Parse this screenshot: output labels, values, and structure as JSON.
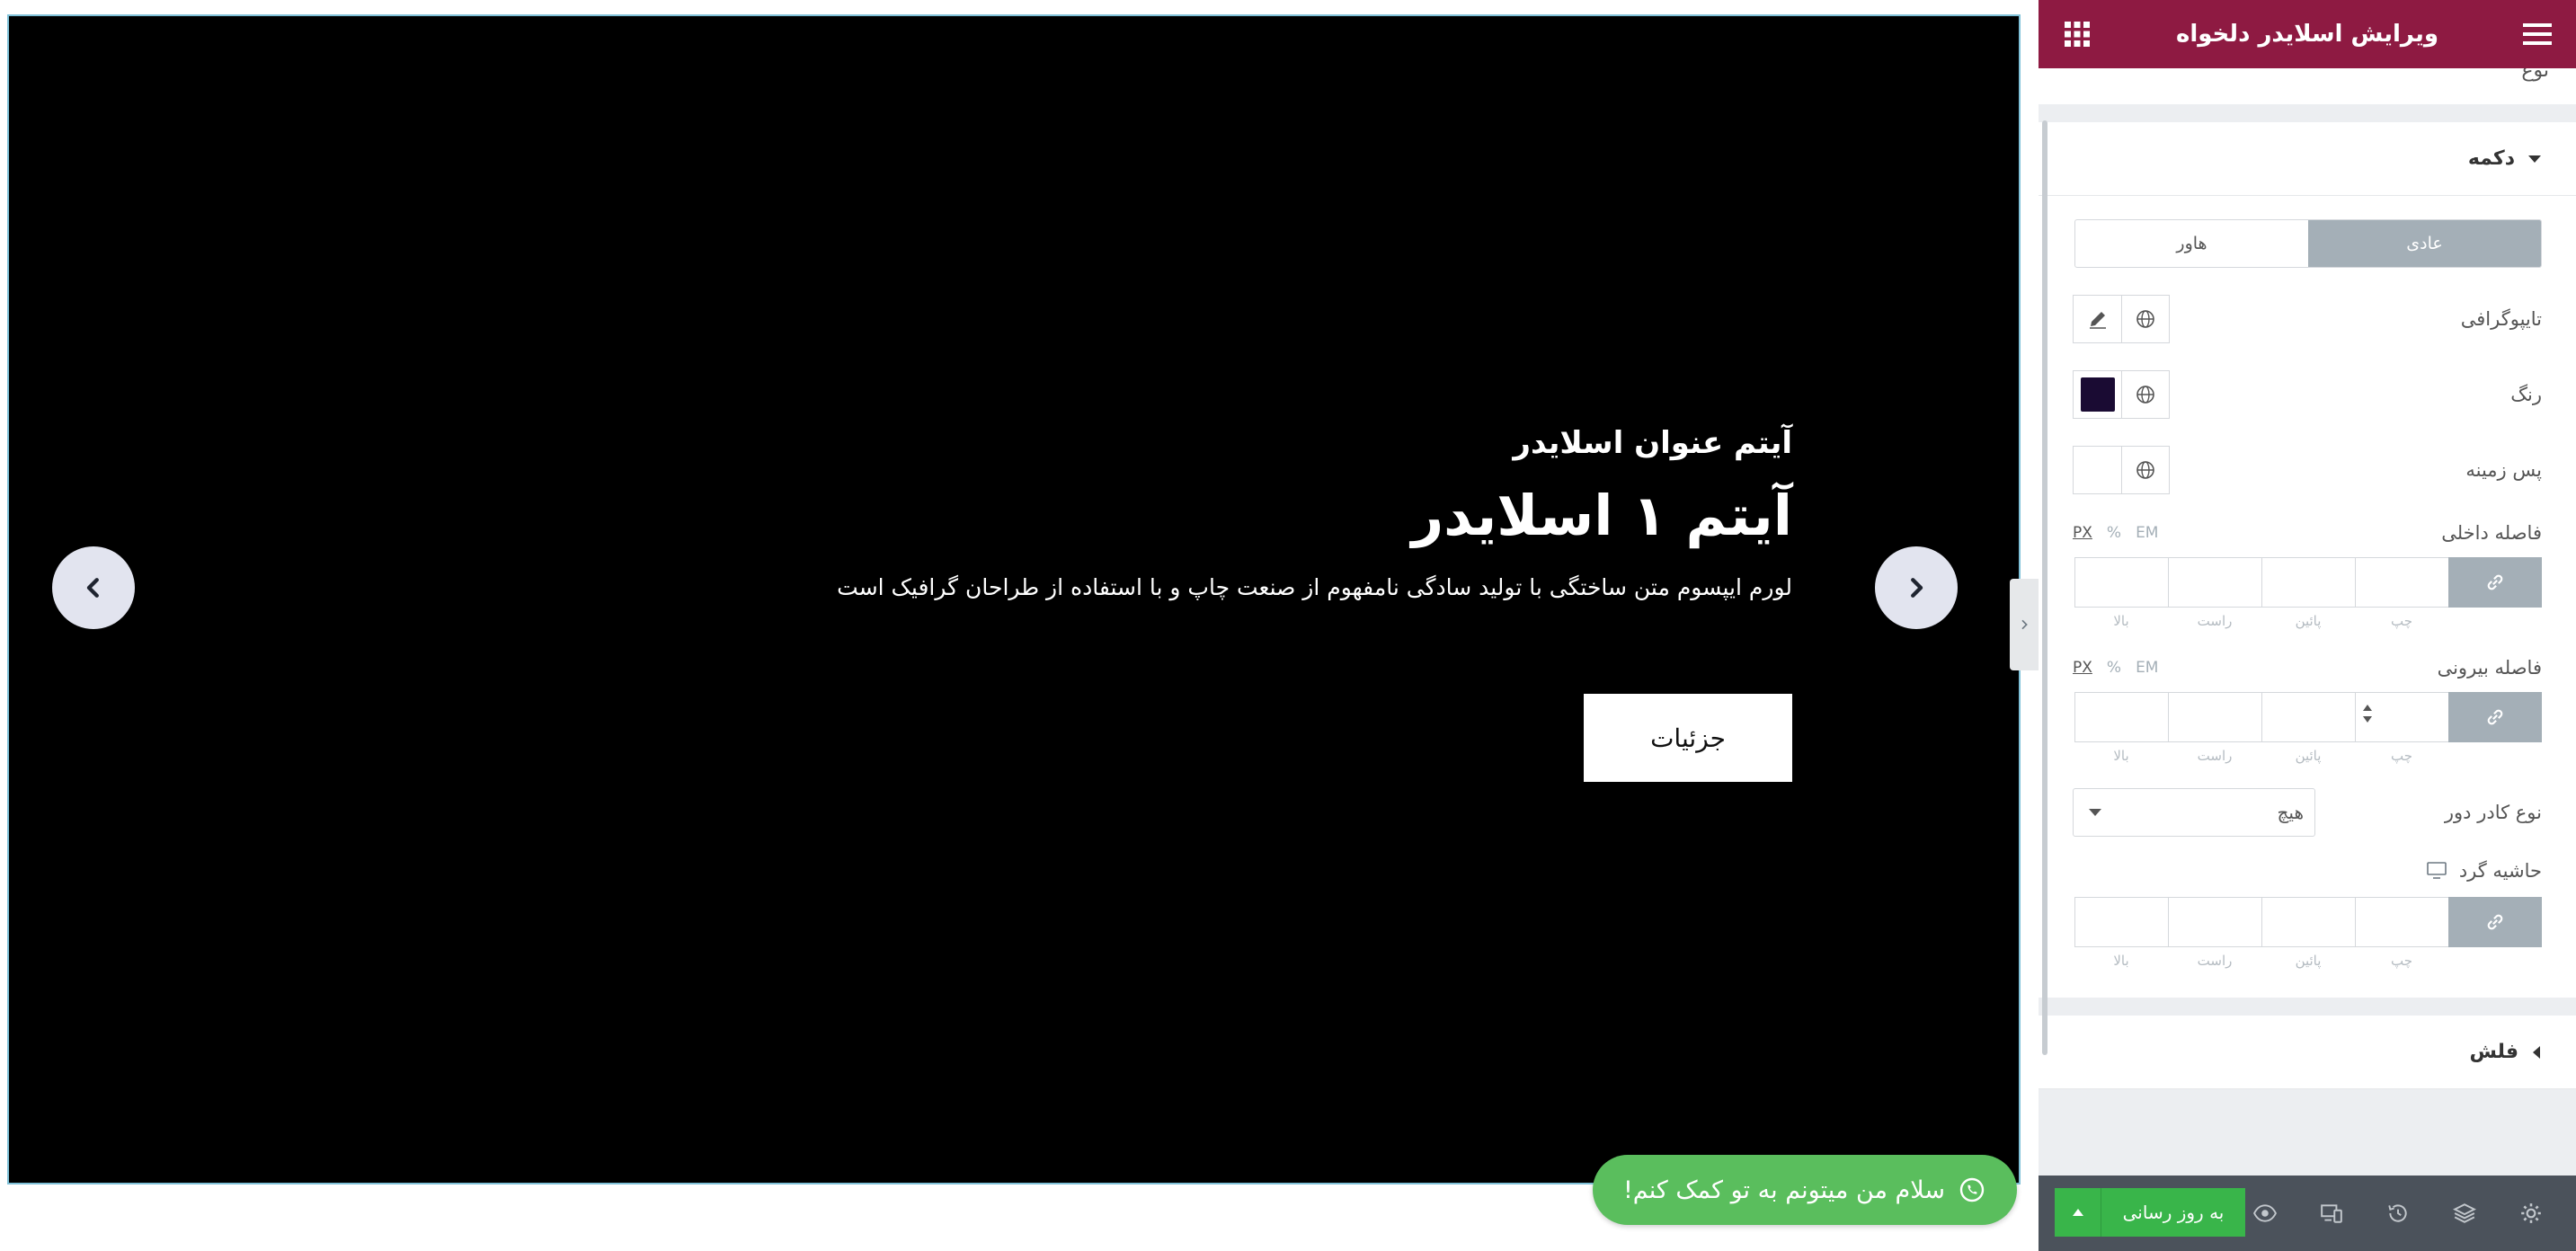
{
  "slider": {
    "subtitle": "آیتم عنوان اسلایدر",
    "title": "آیتم ۱ اسلایدر",
    "description": "لورم ایپسوم متن ساختگی با تولید سادگی نامفهوم از صنعت چاپ و با استفاده از طراحان گرافیک است",
    "button_label": "جزئیات"
  },
  "whatsapp": {
    "label": "سلام من میتونم به تو کمک کنم!"
  },
  "panel": {
    "title": "ویرایش اسلایدر دلخواه",
    "prev_section_label": "نوع",
    "section_button": "دکمه",
    "tabs": {
      "normal": "عادی",
      "hover": "هاور"
    },
    "typography_label": "تایپوگرافی",
    "color_label": "رنگ",
    "background_label": "پس زمینه",
    "padding_label": "فاصله داخلی",
    "margin_label": "فاصله بیرونی",
    "border_type_label": "نوع کادر دور",
    "border_type_value": "هیچ",
    "border_radius_label": "حاشیه گرد",
    "units": {
      "px": "PX",
      "percent": "%",
      "em": "EM"
    },
    "dims": {
      "top": "بالا",
      "right": "راست",
      "bottom": "پائین",
      "left": "چپ"
    },
    "section_arrows": "فلش",
    "update_button": "به روز رسانی"
  },
  "colors": {
    "header_bg": "#8e1a42",
    "swatch": "#1a0b33",
    "update_green": "#39b54a",
    "whatsapp_green": "#5abe5d"
  }
}
